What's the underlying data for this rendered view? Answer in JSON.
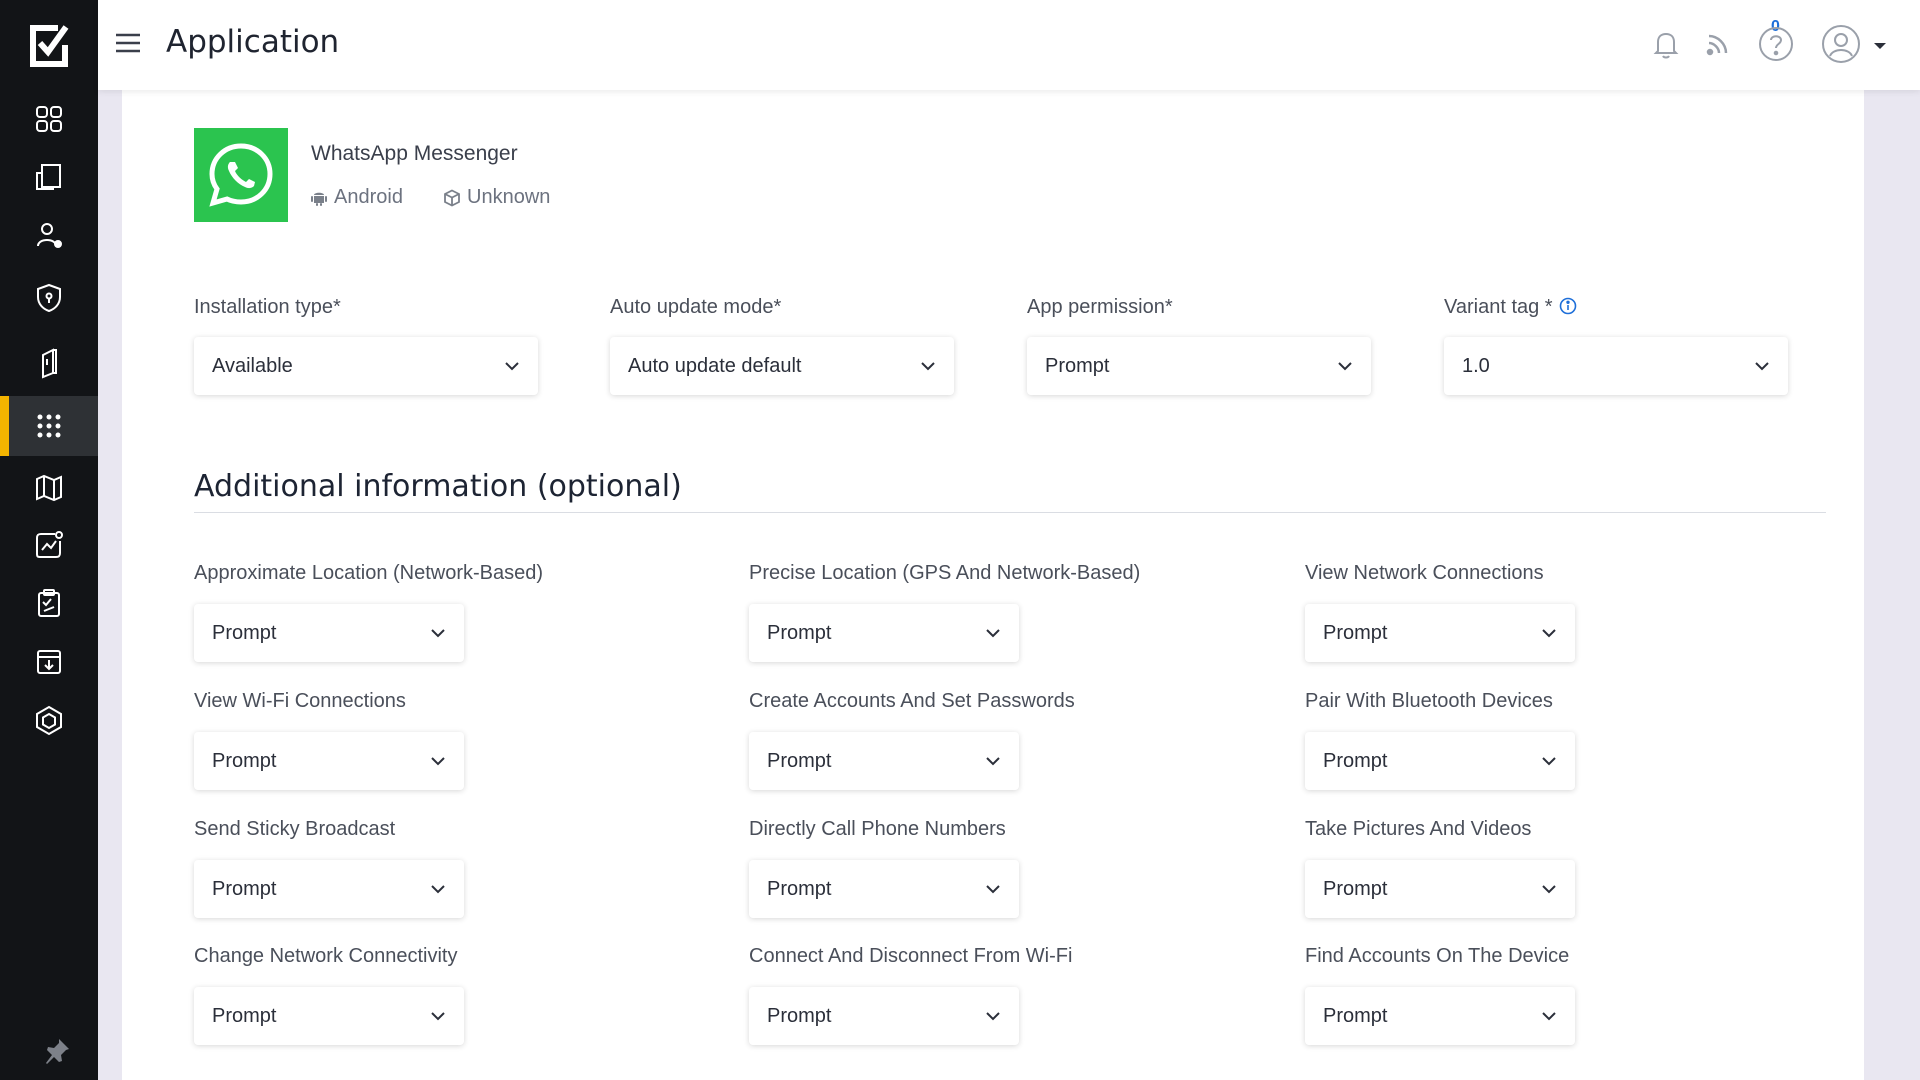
{
  "header": {
    "title": "Application",
    "notification_count": "0"
  },
  "sidebar": {
    "items": [
      {
        "name": "dashboard-icon"
      },
      {
        "name": "devices-icon"
      },
      {
        "name": "users-icon"
      },
      {
        "name": "shield-icon"
      },
      {
        "name": "remote-icon"
      },
      {
        "name": "apps-grid-icon",
        "active": true
      },
      {
        "name": "map-icon"
      },
      {
        "name": "reports-icon"
      },
      {
        "name": "compliance-icon"
      },
      {
        "name": "archive-icon"
      },
      {
        "name": "package-icon"
      }
    ]
  },
  "app": {
    "name": "WhatsApp Messenger",
    "platform": "Android",
    "category": "Unknown"
  },
  "config": {
    "installation_type": {
      "label": "Installation type*",
      "value": "Available"
    },
    "auto_update_mode": {
      "label": "Auto update mode*",
      "value": "Auto update default"
    },
    "app_permission": {
      "label": "App permission*",
      "value": "Prompt"
    },
    "variant_tag": {
      "label": "Variant tag *",
      "value": "1.0"
    }
  },
  "additional": {
    "title": "Additional information (optional)",
    "permissions": [
      {
        "label": "Approximate Location (Network-Based)",
        "value": "Prompt"
      },
      {
        "label": "Precise Location (GPS And Network-Based)",
        "value": "Prompt"
      },
      {
        "label": "View Network Connections",
        "value": "Prompt"
      },
      {
        "label": "View Wi-Fi Connections",
        "value": "Prompt"
      },
      {
        "label": "Create Accounts And Set Passwords",
        "value": "Prompt"
      },
      {
        "label": "Pair With Bluetooth Devices",
        "value": "Prompt"
      },
      {
        "label": "Send Sticky Broadcast",
        "value": "Prompt"
      },
      {
        "label": "Directly Call Phone Numbers",
        "value": "Prompt"
      },
      {
        "label": "Take Pictures And Videos",
        "value": "Prompt"
      },
      {
        "label": "Change Network Connectivity",
        "value": "Prompt"
      },
      {
        "label": "Connect And Disconnect From Wi-Fi",
        "value": "Prompt"
      },
      {
        "label": "Find Accounts On The Device",
        "value": "Prompt"
      }
    ]
  },
  "colors": {
    "sidebar_bg": "#121417",
    "active_accent": "#f4b400",
    "whatsapp_green": "#2bc44f",
    "link_blue": "#1e6fd9"
  }
}
